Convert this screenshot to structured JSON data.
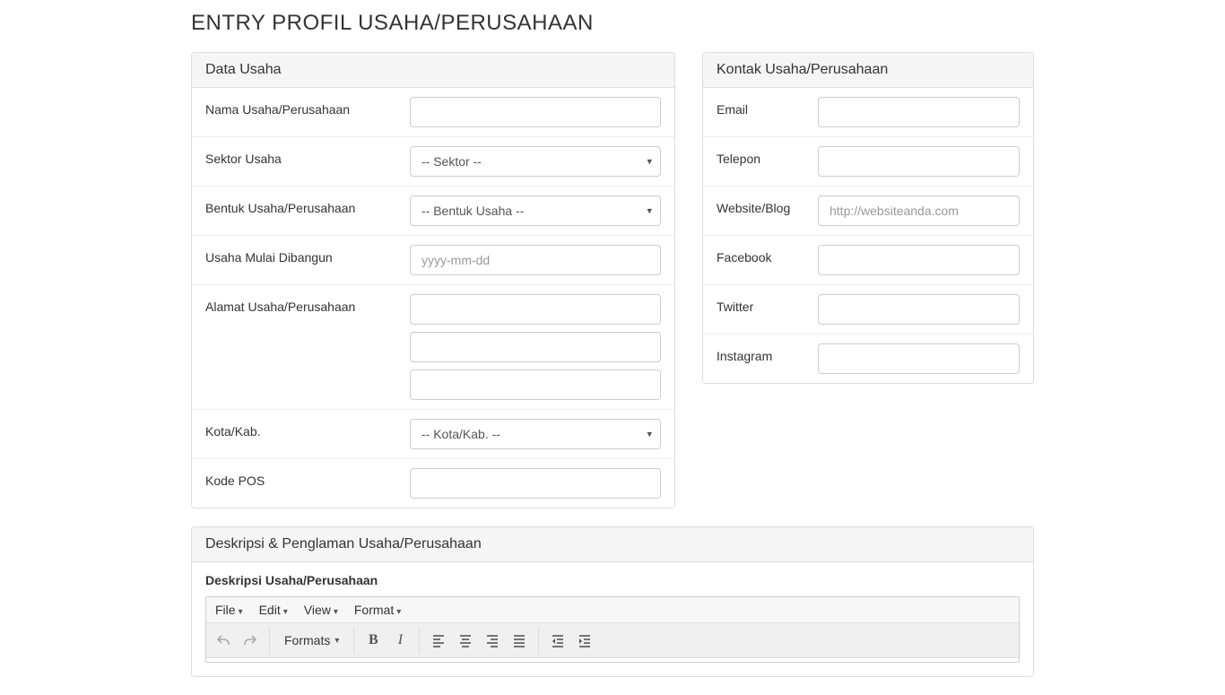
{
  "page": {
    "title": "ENTRY PROFIL USAHA/PERUSAHAAN"
  },
  "dataUsaha": {
    "heading": "Data Usaha",
    "nama_label": "Nama Usaha/Perusahaan",
    "sektor_label": "Sektor Usaha",
    "sektor_selected": "-- Sektor --",
    "bentuk_label": "Bentuk Usaha/Perusahaan",
    "bentuk_selected": "-- Bentuk Usaha --",
    "mulai_label": "Usaha Mulai Dibangun",
    "mulai_placeholder": "yyyy-mm-dd",
    "alamat_label": "Alamat Usaha/Perusahaan",
    "kota_label": "Kota/Kab.",
    "kota_selected": "-- Kota/Kab. --",
    "kodepos_label": "Kode POS"
  },
  "kontak": {
    "heading": "Kontak Usaha/Perusahaan",
    "email_label": "Email",
    "telepon_label": "Telepon",
    "website_label": "Website/Blog",
    "website_placeholder": "http://websiteanda.com",
    "facebook_label": "Facebook",
    "twitter_label": "Twitter",
    "instagram_label": "Instagram"
  },
  "deskripsi": {
    "heading": "Deskripsi & Penglaman Usaha/Perusahaan",
    "subheading": "Deskripsi Usaha/Perusahaan"
  },
  "editor": {
    "menu_file": "File",
    "menu_edit": "Edit",
    "menu_view": "View",
    "menu_format": "Format",
    "formats_label": "Formats"
  }
}
